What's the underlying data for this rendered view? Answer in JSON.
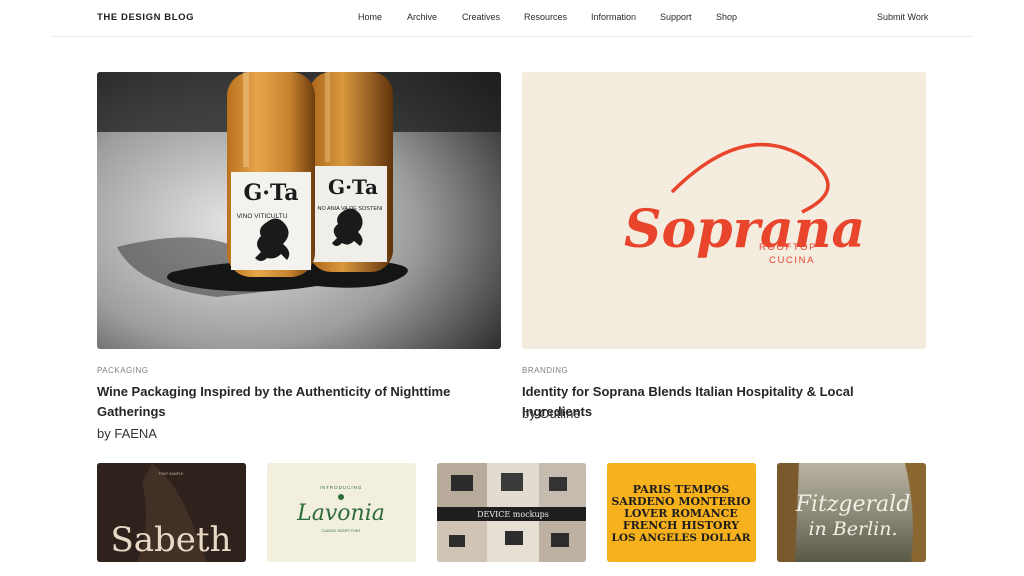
{
  "header": {
    "logo": "THE DESIGN BLOG",
    "nav": [
      "Home",
      "Archive",
      "Creatives",
      "Resources",
      "Information",
      "Support",
      "Shop"
    ],
    "submit": "Submit Work"
  },
  "features": [
    {
      "category": "PACKAGING",
      "title_line1": "Wine Packaging Inspired by the Authenticity of Nighttime",
      "title_line2": "Gatherings",
      "byline": "by FAENA",
      "label_left": "G·Ta",
      "label_right": "G·Ta",
      "label_sub_left": "VINO VITICULTU",
      "label_sub_right": "NO ANIA VA DE SOSTENI"
    },
    {
      "category": "BRANDING",
      "title": "Identity for Soprana Blends Italian Hospitality & Local Ingredients",
      "byline": "by Outline",
      "logo_word": "Soprana",
      "logo_sub_1": "ROOFTOP",
      "logo_sub_2": "CUCINA"
    }
  ],
  "thumbnails": [
    {
      "text": "Sabeth",
      "small": "FONT SAMPLE"
    },
    {
      "text": "Lavonia",
      "small_top": "INTRODUCING",
      "small_bottom": "CLASSIC SCRIPT FONT"
    },
    {
      "text": "DEVICE mockups"
    },
    {
      "lines": [
        "PARIS TEMPOS",
        "SARDENO MONTERIO",
        "LOVER ROMANCE",
        "FRENCH HISTORY",
        "LOS ANGELES DOLLAR"
      ]
    },
    {
      "line1": "Fitzgerald",
      "line2": "in Berlin."
    }
  ],
  "colors": {
    "soprana_red": "#e8452c",
    "soprana_bg": "#f4ecdf",
    "yellow": "#f6b11c",
    "lavonia_green": "#2e6b3a"
  }
}
